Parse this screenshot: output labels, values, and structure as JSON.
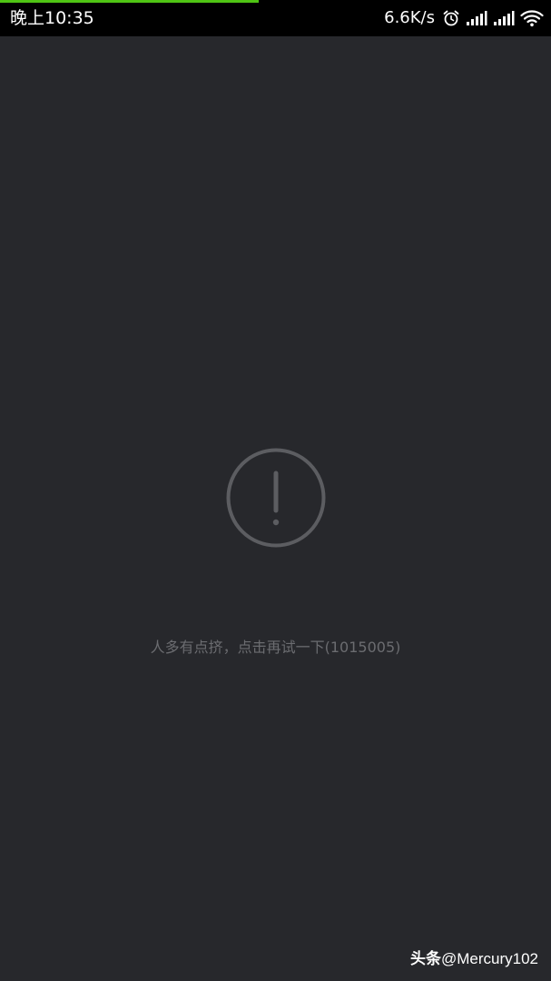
{
  "status_bar": {
    "time": "晚上10:35",
    "net_speed": "6.6K/s",
    "icons": [
      "alarm-icon",
      "signal-icon",
      "signal-icon",
      "wifi-icon"
    ],
    "load_progress_percent": 47,
    "progress_color": "#4fc414"
  },
  "error": {
    "icon": "exclamation-circle-icon",
    "message": "人多有点挤，点击再试一下(1015005)"
  },
  "watermark": {
    "brand": "头条",
    "handle": "@Mercury102"
  },
  "colors": {
    "background": "#27282c",
    "status_bar_bg": "#000000",
    "icon_gray": "#5c5d61",
    "message_gray": "#6b6c70"
  }
}
